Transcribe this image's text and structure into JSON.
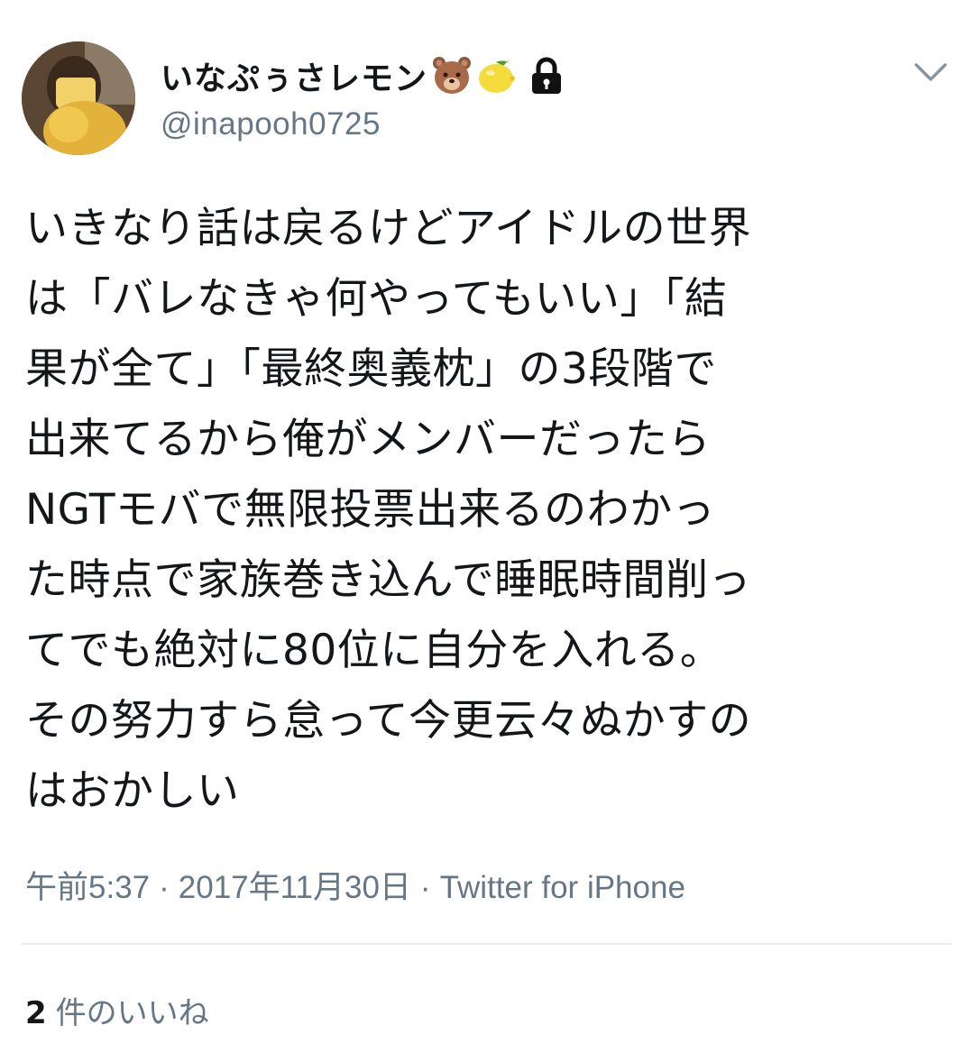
{
  "tweet": {
    "user": {
      "display_name": "いなぷぅさレモン",
      "handle": "@inapooh0725",
      "name_icons": [
        "bear-face-emoji",
        "lemon-emoji",
        "lock-icon"
      ]
    },
    "text": "いきなり話は戻るけどアイドルの世界\nは「バレなきゃ何やってもいい」「結\n果が全て」「最終奥義枕」の3段階で\n出来てるから俺がメンバーだったら\nNGTモバで無限投票出来るのわかっ\nた時点で家族巻き込んで睡眠時間削っ\nてでも絶対に80位に自分を入れる。\nその努力すら怠って今更云々ぬかすの\nはおかしい",
    "meta": {
      "time": "午前5:37",
      "separator": "·",
      "date": "2017年11月30日",
      "source": "Twitter for iPhone"
    },
    "likes": {
      "count": "2",
      "label": "件のいいね"
    }
  },
  "colors": {
    "text_primary": "#14171a",
    "text_secondary": "#657786",
    "divider": "#e6ecf0"
  }
}
